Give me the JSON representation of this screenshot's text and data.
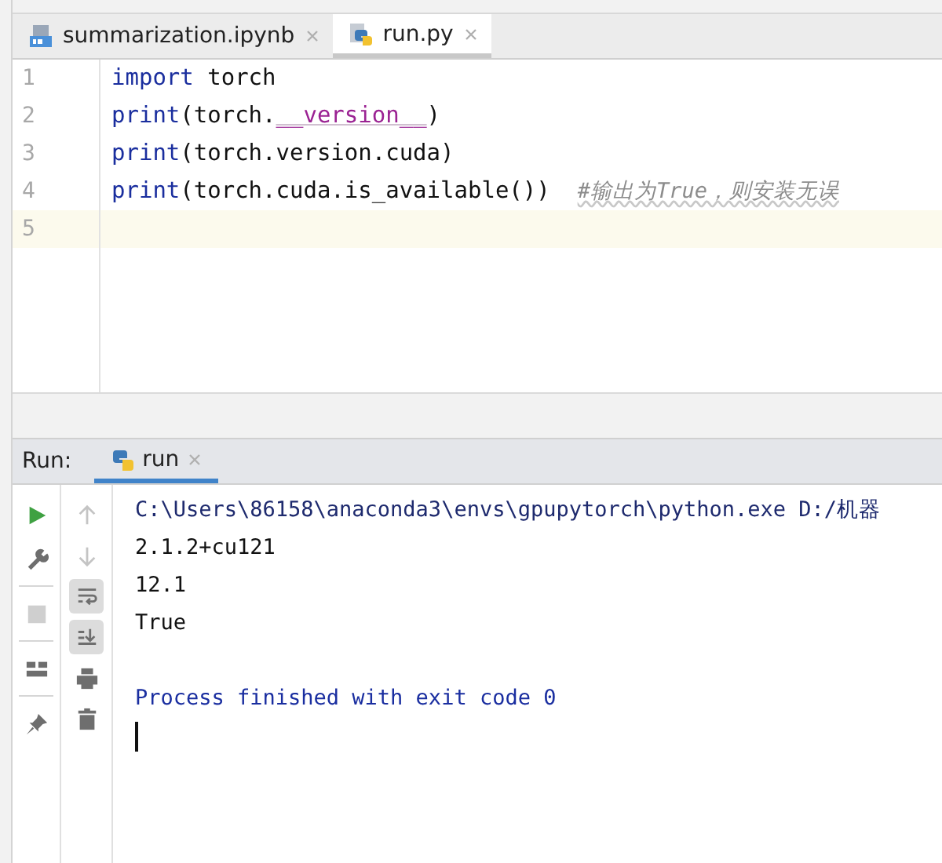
{
  "editor_tabs": [
    {
      "label": "summarization.ipynb",
      "kind": "notebook",
      "selected": false
    },
    {
      "label": "run.py",
      "kind": "python",
      "selected": true
    }
  ],
  "code_lines": [
    {
      "number": "1",
      "current": false,
      "tokens": [
        {
          "kind": "keyword",
          "text": "import"
        },
        {
          "kind": "plain",
          "text": " torch"
        }
      ]
    },
    {
      "number": "2",
      "current": false,
      "tokens": [
        {
          "kind": "keyword",
          "text": "print"
        },
        {
          "kind": "plain",
          "text": "(torch."
        },
        {
          "kind": "magic",
          "text": "__version__"
        },
        {
          "kind": "plain",
          "text": ")"
        }
      ]
    },
    {
      "number": "3",
      "current": false,
      "tokens": [
        {
          "kind": "keyword",
          "text": "print"
        },
        {
          "kind": "plain",
          "text": "(torch.version.cuda)"
        }
      ]
    },
    {
      "number": "4",
      "current": false,
      "tokens": [
        {
          "kind": "keyword",
          "text": "print"
        },
        {
          "kind": "plain",
          "text": "(torch.cuda.is_available())  "
        },
        {
          "kind": "comment",
          "text": "#输出为True，则安装无误"
        }
      ]
    },
    {
      "number": "5",
      "current": true
    }
  ],
  "run_panel": {
    "label": "Run:",
    "tab": {
      "label": "run",
      "selected": true
    },
    "toolbar_left": [
      {
        "kind": "run",
        "disabled": false
      },
      {
        "kind": "wrench",
        "disabled": false
      },
      {
        "kind": "stop",
        "disabled": true
      },
      {
        "kind": "layout",
        "disabled": false
      },
      {
        "kind": "pin",
        "disabled": false
      }
    ],
    "toolbar_right": [
      {
        "kind": "up",
        "on": false,
        "disabled": true
      },
      {
        "kind": "down",
        "on": false,
        "disabled": true
      },
      {
        "kind": "wrap",
        "on": true,
        "disabled": false
      },
      {
        "kind": "scroll",
        "on": true,
        "disabled": false
      },
      {
        "kind": "print",
        "on": false,
        "disabled": false
      },
      {
        "kind": "trash",
        "on": false,
        "disabled": false
      }
    ],
    "console": [
      {
        "kind": "command",
        "text": "C:\\Users\\86158\\anaconda3\\envs\\gpupytorch\\python.exe D:/机器"
      },
      {
        "kind": "output",
        "text": "2.1.2+cu121"
      },
      {
        "kind": "output",
        "text": "12.1"
      },
      {
        "kind": "output",
        "text": "True"
      }
    ],
    "exit_message": "Process finished with exit code 0",
    "cursor": true
  }
}
